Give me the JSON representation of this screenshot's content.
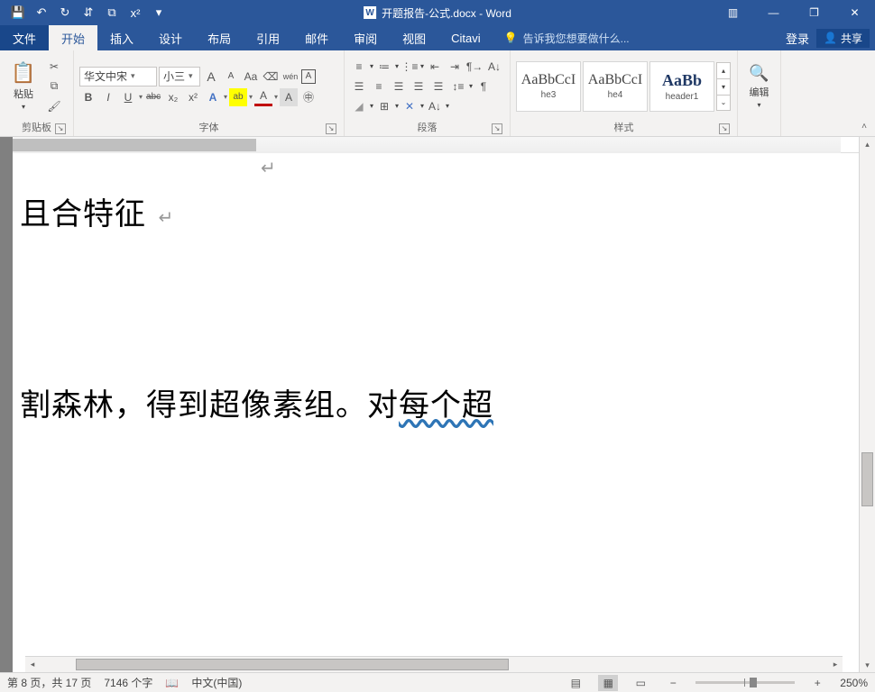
{
  "titlebar": {
    "doc_title": "开题报告-公式.docx - Word",
    "qat": {
      "save": "💾",
      "undo": "↶",
      "redo": "↻",
      "touch": "⇵",
      "new_win": "⧉",
      "super": "x²",
      "more": "▾"
    },
    "rib_opts": "▥",
    "min": "—",
    "max": "❐",
    "close": "✕"
  },
  "tabs": {
    "file": "文件",
    "home": "开始",
    "insert": "插入",
    "design": "设计",
    "layout": "布局",
    "references": "引用",
    "mailings": "邮件",
    "review": "审阅",
    "view": "视图",
    "citavi": "Citavi",
    "tell_me": "告诉我您想要做什么...",
    "login": "登录",
    "share": "共享"
  },
  "ribbon": {
    "clipboard": {
      "paste": "粘贴",
      "label": "剪贴板"
    },
    "font": {
      "name": "华文中宋",
      "size": "小三",
      "bold": "B",
      "italic": "I",
      "underline": "U",
      "strike": "abc",
      "sub": "x₂",
      "sup": "x²",
      "grow": "A",
      "shrink": "A",
      "case": "Aa",
      "clear": "⌫",
      "phon": "wén",
      "border": "A",
      "effects": "A",
      "highlight": "ab",
      "color": "A",
      "shade": "A",
      "circle": "㊥",
      "label": "字体"
    },
    "para": {
      "label": "段落"
    },
    "styles": {
      "items": [
        {
          "preview": "AaBbCcI",
          "name": "he3"
        },
        {
          "preview": "AaBbCcI",
          "name": "he4"
        },
        {
          "preview": "AaBb",
          "name": "header1"
        }
      ],
      "label": "样式"
    },
    "editing": {
      "label": "编辑"
    }
  },
  "doc": {
    "line1": "且合特征",
    "line2a": "割森林，得到超像素组。对",
    "line2b": "每个超"
  },
  "status": {
    "page": "第 8 页，共 17 页",
    "words": "7146 个字",
    "lang": "中文(中国)",
    "zoom": "250%"
  }
}
